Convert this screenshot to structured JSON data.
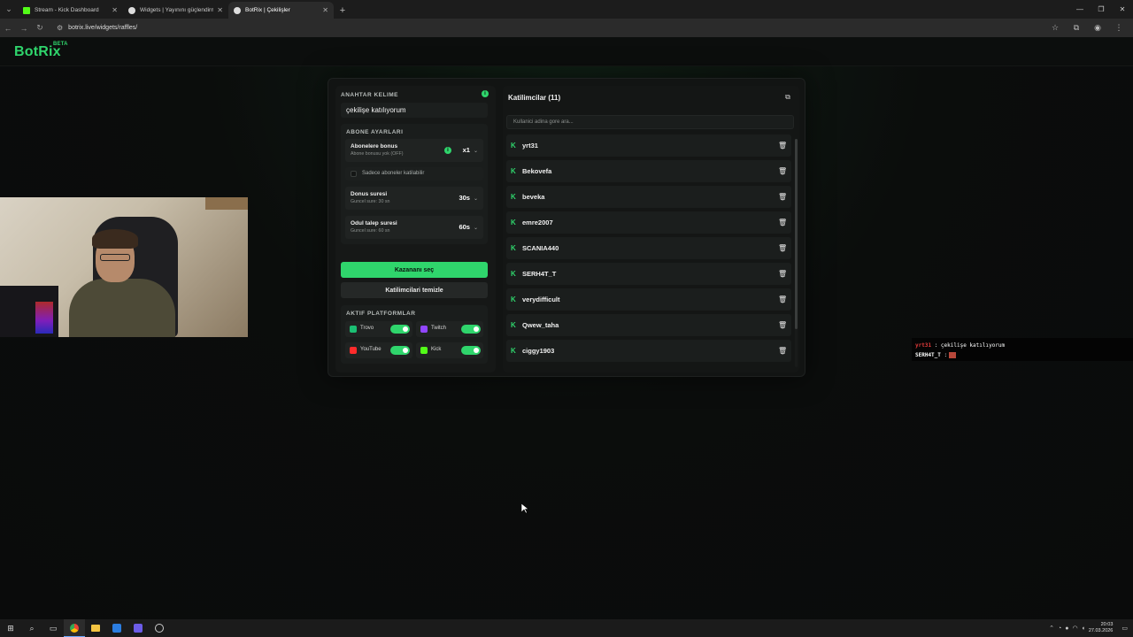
{
  "browser": {
    "tabs": [
      {
        "title": "Stream - Kick Dashboard",
        "favicon_color": "#53fc18"
      },
      {
        "title": "Widgets | Yayınını güçlendirme...",
        "favicon_color": "#ffffff"
      },
      {
        "title": "BotRix | Çekilişler",
        "favicon_color": "#ffffff"
      }
    ],
    "url": "botrix.live/widgets/raffles/"
  },
  "site": {
    "logo": "BotRix",
    "beta": "BETA"
  },
  "keyword": {
    "label": "ANAHTAR KELIME",
    "value": "çekilişe katılıyorum"
  },
  "subscriber_settings": {
    "title": "ABONE AYARLARI",
    "bonus": {
      "label": "Abonelere bonus",
      "hint": "Abone bonusu yok (OFF)",
      "value": "x1"
    },
    "only_subs": {
      "label": "Sadece aboneler katilabilir",
      "checked": false
    },
    "bonus_time": {
      "label": "Donus suresi",
      "hint": "Guncel sure: 30 sn",
      "value": "30s"
    },
    "claim_time": {
      "label": "Odul talep suresi",
      "hint": "Guncel sure: 60 sn",
      "value": "60s"
    }
  },
  "buttons": {
    "pick_winner": "Kazananı seç",
    "clear_participants": "Katilimcilari temizle"
  },
  "platforms": {
    "title": "AKTIF PLATFORMLAR",
    "items": [
      {
        "name": "Trovo",
        "color": "#1bbf73",
        "enabled": true
      },
      {
        "name": "Twitch",
        "color": "#9146ff",
        "enabled": true
      },
      {
        "name": "YouTube",
        "color": "#ff2b2b",
        "enabled": true
      },
      {
        "name": "Kick",
        "color": "#53fc18",
        "enabled": true
      }
    ]
  },
  "participants": {
    "title": "Katilimcilar (11)",
    "search_placeholder": "Kullanici adina gore ara...",
    "items": [
      "yrt31",
      "Bekovefa",
      "beveka",
      "emre2007",
      "SCANIA440",
      "SERH4T_T",
      "verydifficult",
      "Qwew_taha",
      "ciggy1903"
    ]
  },
  "chat": [
    {
      "user": "yrt31",
      "message": ": çekilişe katılıyorum"
    },
    {
      "user": "SERH4T_T",
      "message": ":"
    }
  ],
  "taskbar": {
    "time": "20:03",
    "date": "27.03.2026"
  }
}
